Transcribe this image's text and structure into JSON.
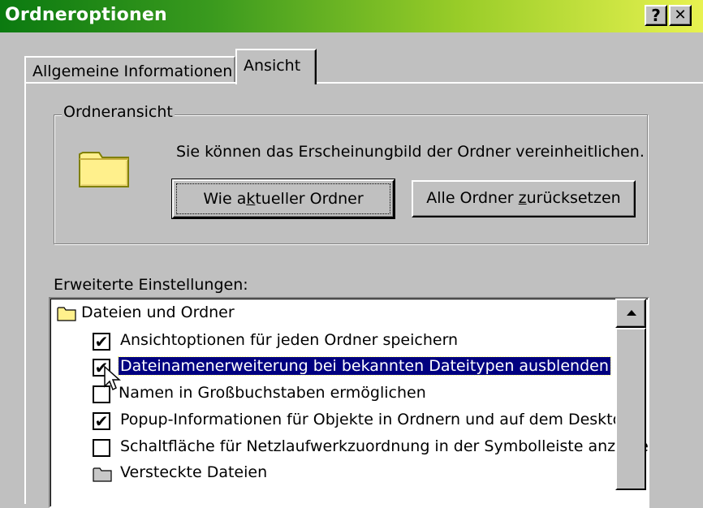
{
  "window": {
    "title": "Ordneroptionen",
    "help_button": "?",
    "close_button": "✕"
  },
  "tabs": [
    {
      "label": "Allgemeine Informationen",
      "active": false
    },
    {
      "label": "Ansicht",
      "active": true
    }
  ],
  "folder_view_group": {
    "label": "Ordneransicht",
    "description": "Sie können das Erscheinungbild der Ordner vereinheitlichen.",
    "button_current_prefix": "Wie a",
    "button_current_accel": "k",
    "button_current_suffix": "tueller Ordner",
    "button_reset_prefix": "Alle Ordner ",
    "button_reset_accel": "z",
    "button_reset_suffix": "urücksetzen"
  },
  "advanced": {
    "label": "Erweiterte Einstellungen:",
    "items": [
      {
        "type": "folder",
        "label": "Dateien und Ordner"
      },
      {
        "type": "checkbox",
        "checked": true,
        "label": "Ansichtoptionen für jeden Ordner speichern"
      },
      {
        "type": "checkbox",
        "checked": true,
        "label": "Dateinamenerweiterung bei bekannten Dateitypen ausblenden",
        "selected": true
      },
      {
        "type": "checkbox",
        "checked": false,
        "label": "Namen in Großbuchstaben ermöglichen"
      },
      {
        "type": "checkbox",
        "checked": true,
        "label": "Popup-Informationen für Objekte in Ordnern und auf dem Desktop a"
      },
      {
        "type": "checkbox",
        "checked": false,
        "label": "Schaltfläche für Netzlaufwerkzuordnung in der Symbolleiste anzeige"
      },
      {
        "type": "folder",
        "label": "Versteckte Dateien"
      }
    ],
    "check_glyph": "✔"
  },
  "colors": {
    "title_gradient_start": "#0b7a10",
    "title_gradient_end": "#e8f250",
    "selection": "#000080",
    "face": "#c0c0c0",
    "folder": "#fff08c"
  },
  "icons": [
    "folder-icon",
    "scroll-up-arrow-icon",
    "mouse-cursor-icon",
    "checkbox-icon"
  ]
}
